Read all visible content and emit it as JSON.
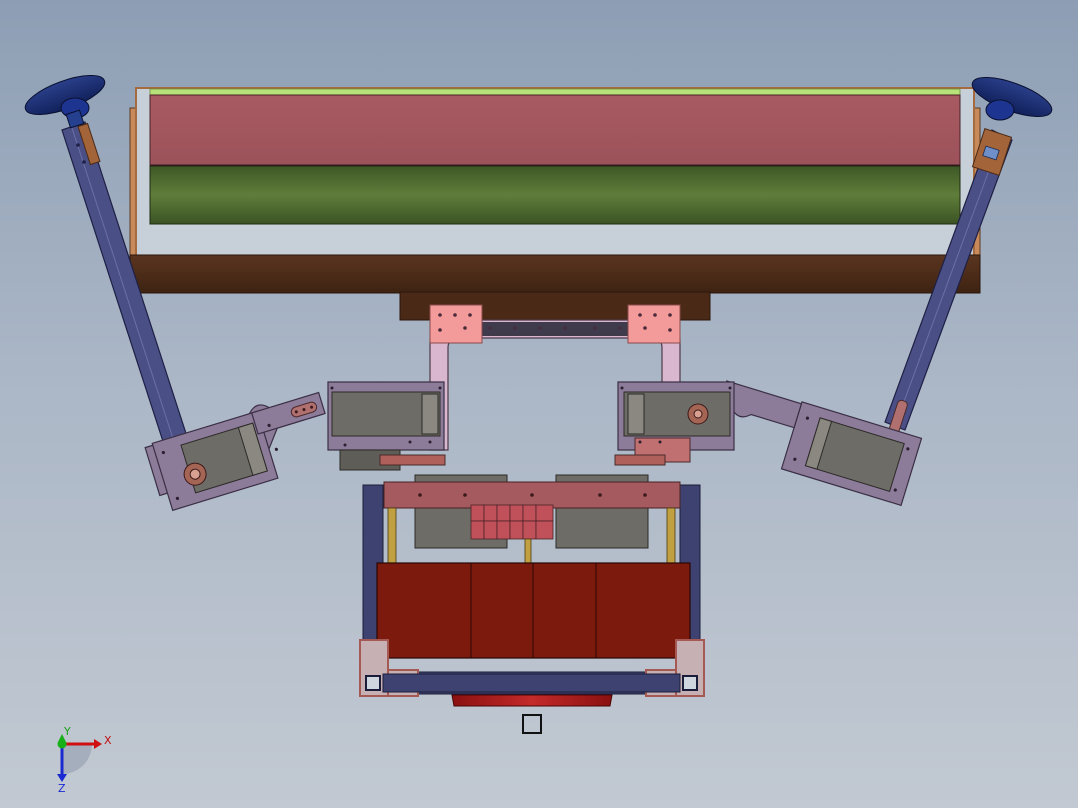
{
  "triad": {
    "x_label": "X",
    "y_label": "Y",
    "z_label": "Z"
  },
  "colors": {
    "background_top": "#8d9eb4",
    "background_bottom": "#c2c9d2",
    "red_panel": "#a3585f",
    "green_panel": "#4f6a2f",
    "lime_edge": "#b7e27a",
    "brown_base": "#4a2a17",
    "arm_blue": "#4a4f86",
    "servo_plate": "#8d7b9a",
    "servo_body": "#6e6c66",
    "battery_red": "#7c1a0d",
    "pink_bracket": "#f08c8c",
    "frame_navy": "#3d4270",
    "rust": "#a45a52"
  }
}
